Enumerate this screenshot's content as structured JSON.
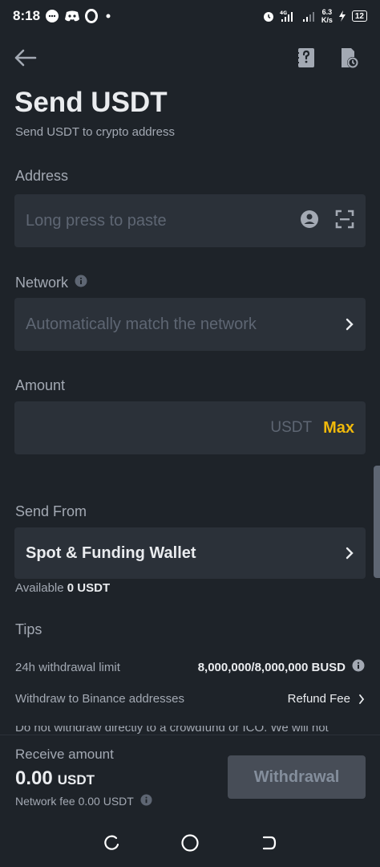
{
  "status_bar": {
    "time": "8:18",
    "net_type": "4G",
    "net_speed_value": "6.3",
    "net_speed_unit": "K/s",
    "battery": "12"
  },
  "header": {
    "title": "Send USDT",
    "subtitle": "Send USDT to crypto address"
  },
  "address": {
    "label": "Address",
    "placeholder": "Long press to paste"
  },
  "network": {
    "label": "Network",
    "placeholder": "Automatically match the network"
  },
  "amount": {
    "label": "Amount",
    "unit": "USDT",
    "max_label": "Max"
  },
  "send_from": {
    "label": "Send From",
    "wallet": "Spot & Funding Wallet",
    "available_label": "Available",
    "available_value": "0 USDT"
  },
  "tips": {
    "title": "Tips",
    "limit_label": "24h withdrawal limit",
    "limit_value": "8,000,000/8,000,000 BUSD",
    "binance_label": "Withdraw to Binance addresses",
    "binance_link": "Refund Fee",
    "warning": "Do not withdraw directly to a crowdfund or ICO. We will not"
  },
  "footer": {
    "receive_label": "Receive amount",
    "receive_value": "0.00",
    "receive_unit": "USDT",
    "network_fee": "Network fee 0.00 USDT",
    "withdraw_label": "Withdrawal"
  },
  "colors": {
    "background": "#1e2329",
    "field": "#2b3139",
    "accent": "#f0b90b"
  }
}
